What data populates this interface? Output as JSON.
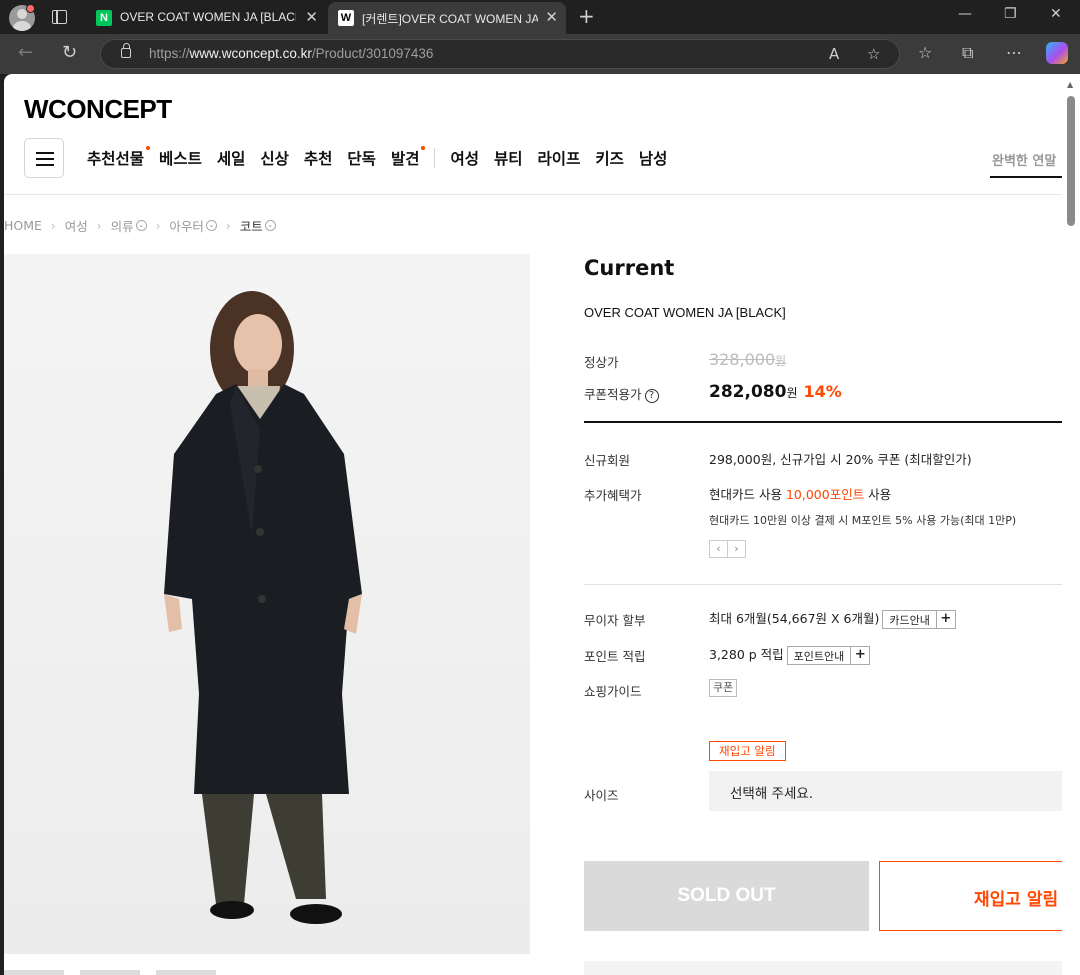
{
  "browser": {
    "tabs": [
      {
        "favicon": "N",
        "title": "OVER COAT WOMEN JA [BLACK] : ",
        "active": false
      },
      {
        "favicon": "W",
        "title": "[커렌트]OVER COAT WOMEN JA [",
        "active": true
      }
    ],
    "url_prefix": "https://",
    "url_host": "www.wconcept.co.kr",
    "url_path": "/Product/301097436"
  },
  "site": {
    "logo": "WCONCEPT",
    "nav": [
      {
        "label": "추천선물",
        "dot": true
      },
      {
        "label": "베스트",
        "dot": false
      },
      {
        "label": "세일",
        "dot": false
      },
      {
        "label": "신상",
        "dot": false
      },
      {
        "label": "추천",
        "dot": false
      },
      {
        "label": "단독",
        "dot": false
      },
      {
        "label": "발견",
        "dot": true
      }
    ],
    "nav2": [
      "여성",
      "뷰티",
      "라이프",
      "키즈",
      "남성"
    ],
    "search_placeholder": "완벽한 연말"
  },
  "breadcrumb": [
    "HOME",
    "여성",
    "의류",
    "아우터",
    "코트"
  ],
  "product": {
    "brand": "Current",
    "name": "OVER COAT WOMEN JA [BLACK]",
    "regular_label": "정상가",
    "regular_price": "328,000",
    "coupon_label": "쿠폰적용가",
    "coupon_price": "282,080",
    "won": "원",
    "discount": "14%",
    "new_member_label": "신규회원",
    "new_member_value": "298,000원, 신규가입 시 20% 쿠폰 (최대할인가)",
    "extra_label": "추가혜택가",
    "extra_value_pre": "현대카드 사용 ",
    "extra_value_highlight": "10,000포인트",
    "extra_value_post": " 사용",
    "extra_sub": "현대카드 10만원 이상 결제 시 M포인트 5% 사용 가능(최대 1만P)",
    "installment_label": "무이자 할부",
    "installment_value": "최대 6개월(54,667원 X 6개월)",
    "card_guide": "카드안내",
    "point_label": "포인트 적립",
    "point_value": "3,280 p 적립",
    "point_guide": "포인트안내",
    "shopping_label": "쇼핑가이드",
    "coupon_tag": "쿠폰",
    "restock_tag": "재입고 알림",
    "size_label": "사이즈",
    "size_placeholder": "선택해 주세요.",
    "soldout_label": "SOLD OUT",
    "restock_button": "재입고 알림"
  },
  "colors": {
    "accent": "#ff4800",
    "soldout": "#dadada"
  }
}
